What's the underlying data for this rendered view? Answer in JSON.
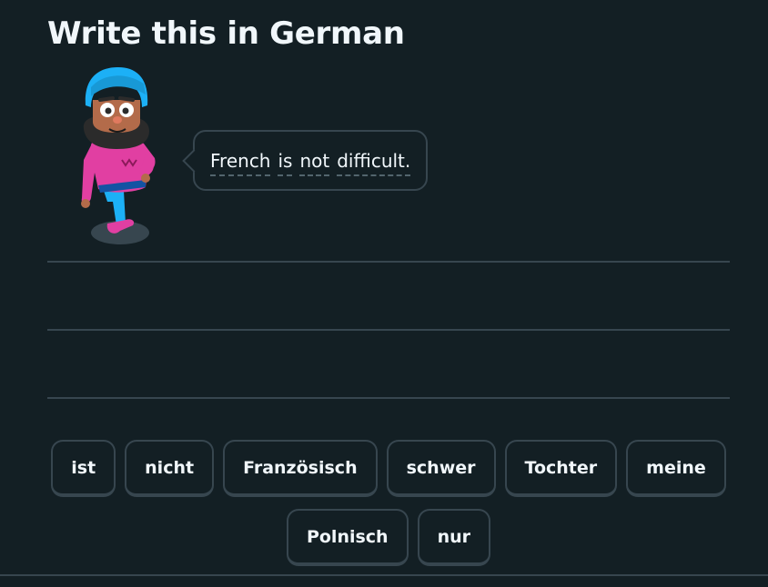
{
  "challenge": {
    "title": "Write this in German"
  },
  "prompt": {
    "words": [
      "French",
      "is",
      "not",
      "difficult."
    ]
  },
  "word_bank": {
    "tiles": [
      "ist",
      "nicht",
      "Französisch",
      "schwer",
      "Tochter",
      "meine",
      "Polnisch",
      "nur"
    ]
  },
  "colors": {
    "background": "#131f24",
    "border": "#37464f",
    "text": "#f1f7fb",
    "character_turban": "#1cb0f6",
    "character_sweater": "#e13fa2",
    "character_pants": "#1cb0f6"
  }
}
